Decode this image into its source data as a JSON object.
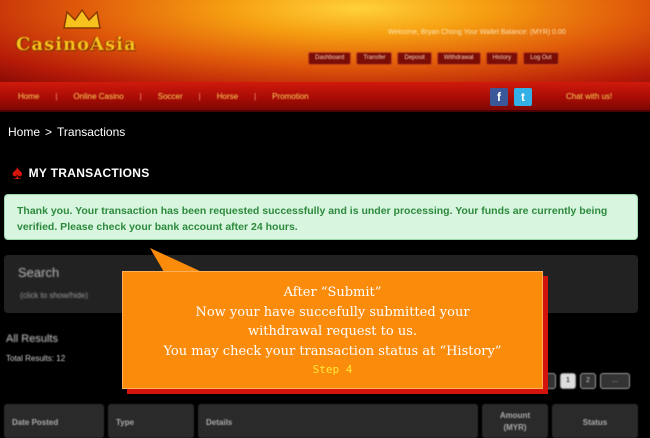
{
  "site": {
    "logo_text": "CasinoAsia",
    "welcome_text": "Welcome, Bryan Chong    Your Wallet Balance: (MYR) 0.00",
    "top_buttons": [
      "Dashboard",
      "Transfer",
      "Deposit",
      "Withdrawal",
      "History",
      "Log Out"
    ],
    "nav_items": [
      "Home",
      "Online Casino",
      "Soccer",
      "Horse",
      "Promotion"
    ],
    "social": {
      "facebook": "f",
      "twitter": "t"
    },
    "chat_label": "Chat with us!"
  },
  "breadcrumb": {
    "home": "Home",
    "separator": ">",
    "current": "Transactions"
  },
  "page_title": "MY TRANSACTIONS",
  "success_message": "Thank you. Your transaction has been requested successfully and is under processing. Your funds are currently being verified. Please check your bank account after 24 hours.",
  "search": {
    "title": "Search",
    "toggle": "(click to show/hide)"
  },
  "results": {
    "heading": "All Results",
    "total": "Total Results: 12"
  },
  "pagination": {
    "pages": [
      "1",
      "2",
      "..."
    ],
    "current": "1"
  },
  "table": {
    "columns": [
      "Date Posted",
      "Type",
      "Details",
      "Amount (MYR)",
      "Status"
    ]
  },
  "callout": {
    "lines": [
      "After “Submit”",
      "Now your have succefully submitted your",
      "withdrawal request to us.",
      "You may check your transaction status at “History”"
    ],
    "step": "Step 4"
  },
  "colors": {
    "accent_red": "#d01a0c",
    "success_bg": "#d7f5df",
    "success_text": "#2d8a3c",
    "callout_bg": "#fb8b0b",
    "callout_shadow": "#d2140a",
    "step_text": "#ffea3a"
  }
}
